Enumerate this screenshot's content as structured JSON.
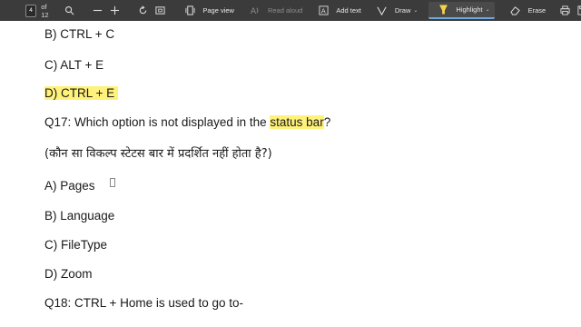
{
  "toolbar": {
    "page_number": "4",
    "of_pages": "of 12",
    "page_view": "Page view",
    "read_aloud": "Read aloud",
    "add_text": "Add text",
    "draw": "Draw",
    "highlight": "Highlight",
    "erase": "Erase",
    "icons": [
      "search-icon",
      "zoom-out-icon",
      "zoom-in-icon",
      "rotate-icon",
      "fit-page-icon",
      "page-view-icon",
      "read-aloud-icon",
      "add-text-icon",
      "draw-icon",
      "highlight-icon",
      "erase-icon",
      "print-icon",
      "save-icon",
      "save-as-icon"
    ]
  },
  "document": {
    "line1": "B) CTRL + C",
    "line2": "C) ALT + E",
    "line3": "D) CTRL + E",
    "q17_prefix": "Q17: Which option is not displayed in the ",
    "q17_highlight": "status bar",
    "q17_suffix": "?",
    "q17_hindi": "(कौन सा विकल्प स्टेटस बार में प्रदर्शित नहीं होता है?)",
    "opt_a": "A) Pages",
    "opt_b": "B) Language",
    "opt_c": "C) FileType",
    "opt_d": "D) Zoom",
    "q18": "Q18: CTRL + Home is used to go to-"
  },
  "colors": {
    "toolbar_bg": "#3b3b3b",
    "highlight": "#fff27a",
    "page_bg": "#ffffff"
  }
}
